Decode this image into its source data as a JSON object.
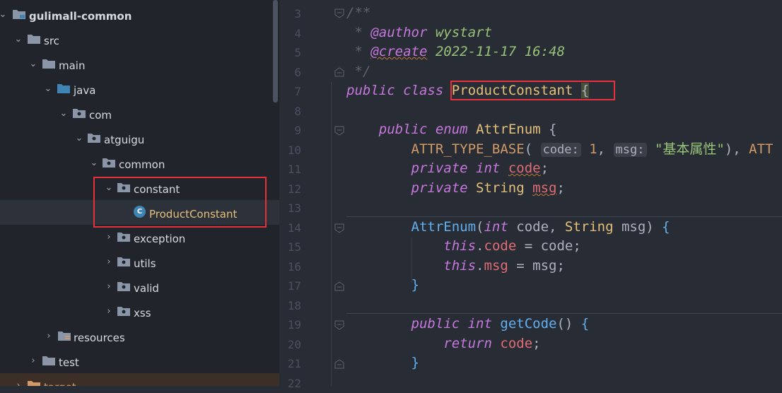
{
  "tree": {
    "items": [
      {
        "label": "gulimall-common",
        "expanded": true
      },
      {
        "label": "src",
        "expanded": true
      },
      {
        "label": "main",
        "expanded": true
      },
      {
        "label": "java",
        "expanded": true
      },
      {
        "label": "com",
        "expanded": true
      },
      {
        "label": "atguigu",
        "expanded": true
      },
      {
        "label": "common",
        "expanded": true
      },
      {
        "label": "constant",
        "expanded": true
      },
      {
        "label": "ProductConstant",
        "class_icon": "C"
      },
      {
        "label": "exception",
        "expanded": false
      },
      {
        "label": "utils",
        "expanded": false
      },
      {
        "label": "valid",
        "expanded": false
      },
      {
        "label": "xss",
        "expanded": false
      },
      {
        "label": "resources",
        "expanded": false
      },
      {
        "label": "test",
        "expanded": false
      },
      {
        "label": "target",
        "expanded": false
      }
    ]
  },
  "editor": {
    "line_numbers": [
      "3",
      "4",
      "5",
      "6",
      "7",
      "8",
      "9",
      "10",
      "11",
      "12",
      "13",
      "14",
      "15",
      "16",
      "17",
      "18",
      "19",
      "20",
      "21",
      "22"
    ],
    "author_tag": "@author",
    "author_value": "wystart",
    "create_tag": "@create",
    "create_value": "2022-11-17 16:48",
    "class_name": "ProductConstant",
    "enum_name": "AttrEnum",
    "enum_const": "ATTR_TYPE_BASE",
    "hint_code": "code:",
    "hint_msg": "msg:",
    "enum_arg_num": "1",
    "enum_arg_str": "\"基本属性\"",
    "enum_tail": "ATT"
  },
  "colors": {
    "highlight_box": "#e5313b"
  }
}
